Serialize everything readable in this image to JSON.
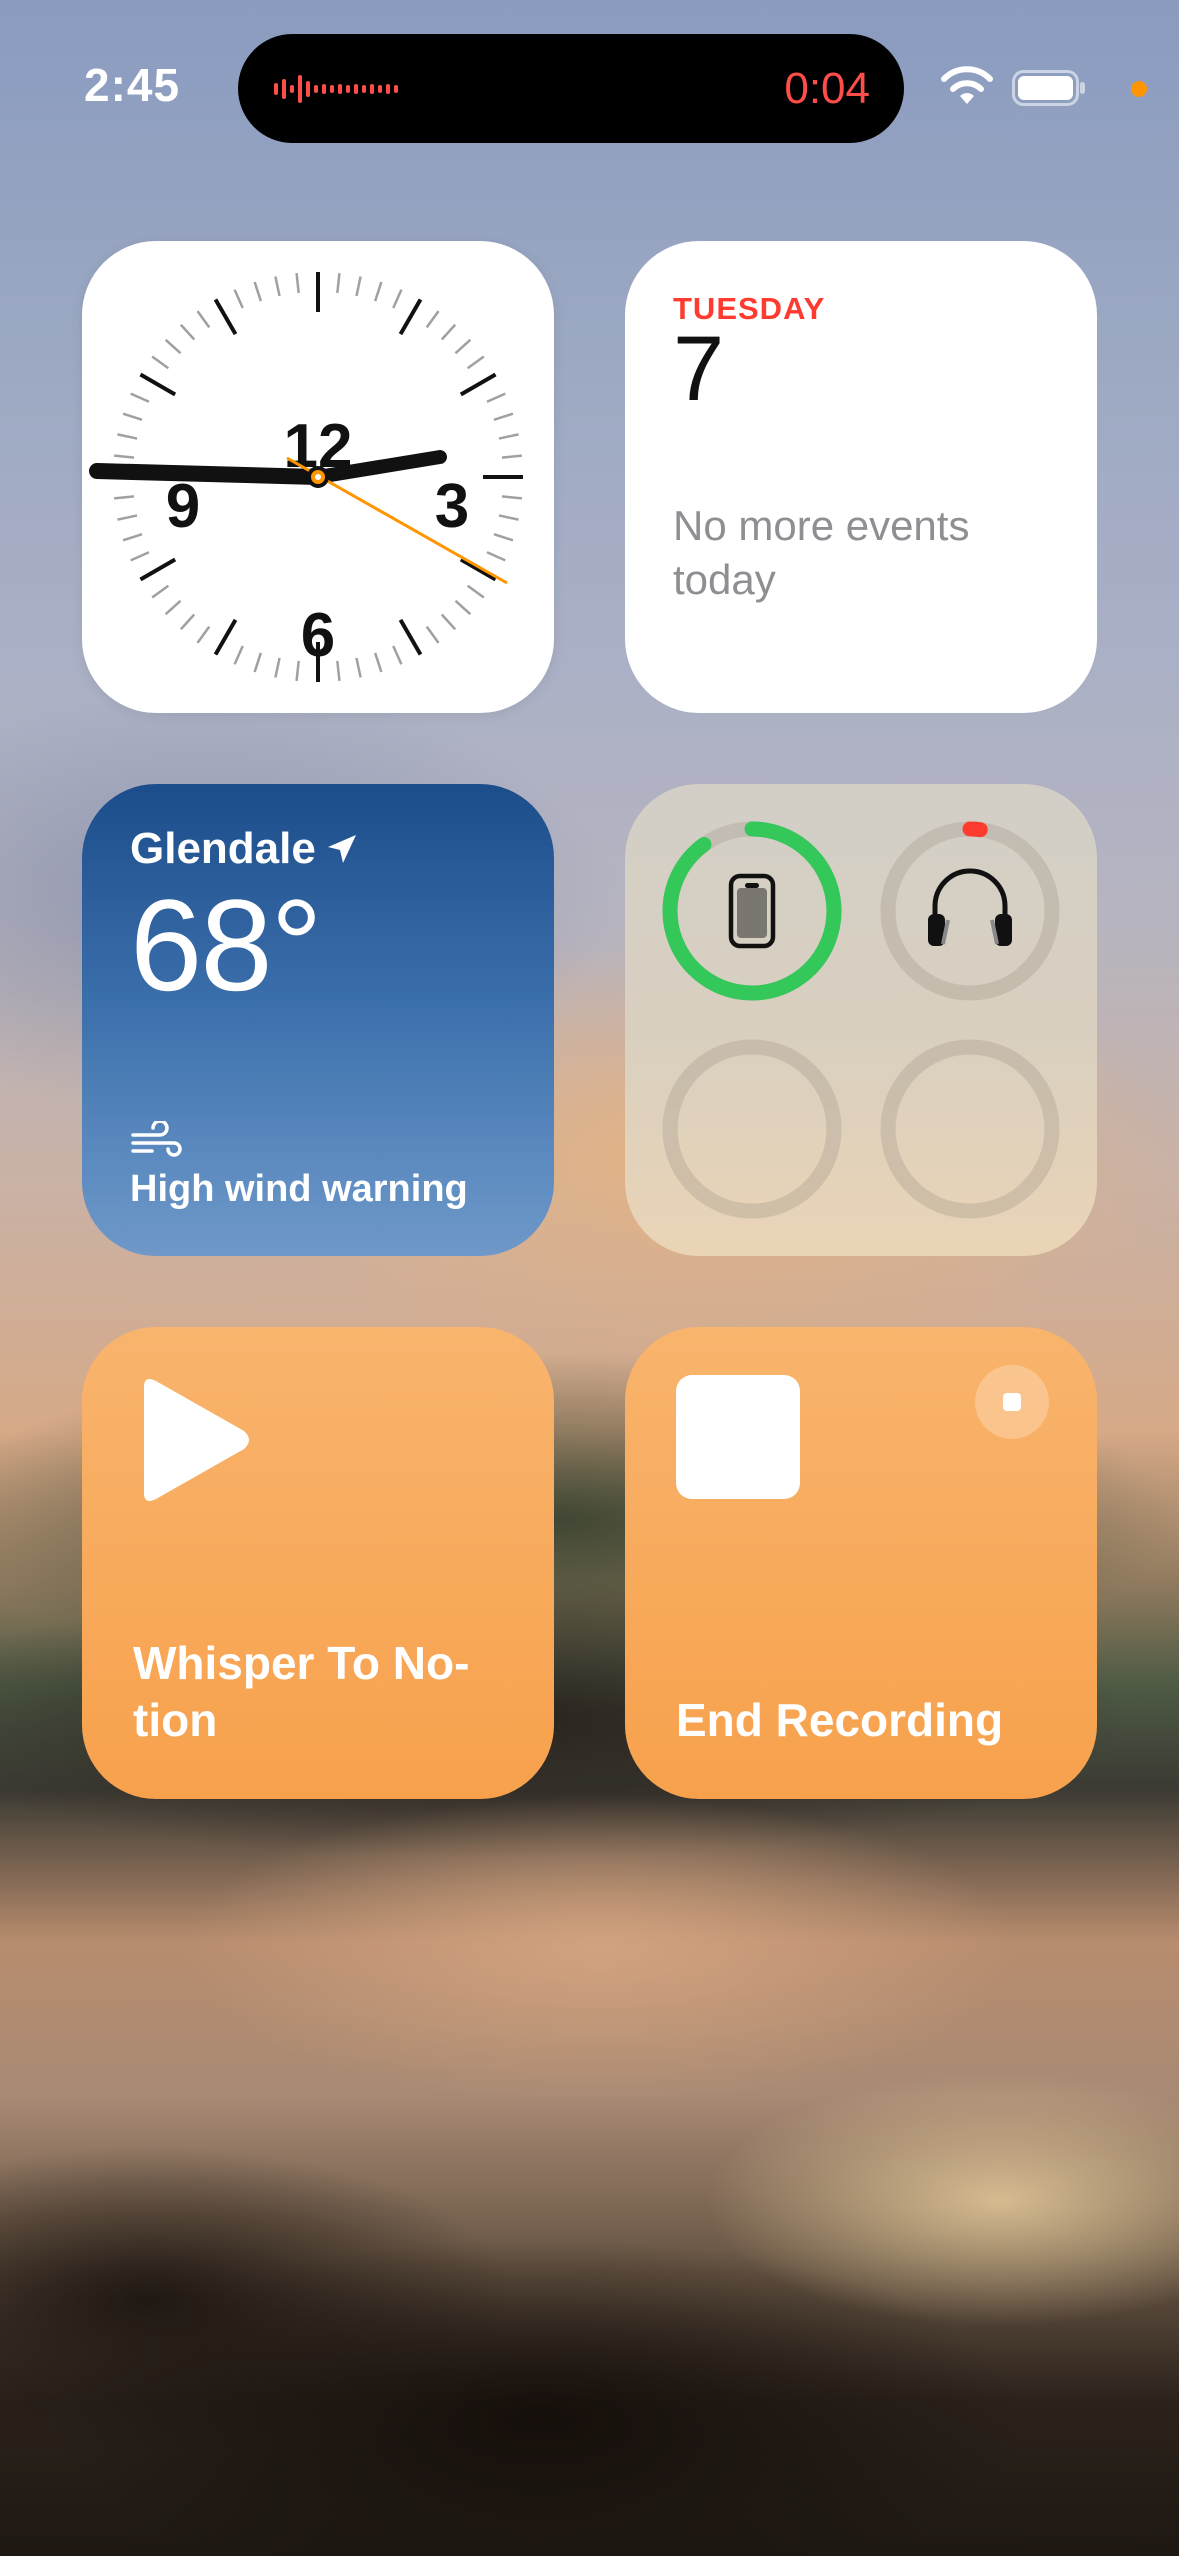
{
  "status_bar": {
    "time": "2:45",
    "recording_timer": "0:04",
    "icons": [
      "waveform-icon",
      "wifi-icon",
      "battery-icon",
      "privacy-indicator-dot"
    ],
    "recording_color": "#ff4d4a",
    "privacy_dot_color": "#ff9500"
  },
  "clock_widget": {
    "numerals": [
      "12",
      "3",
      "6",
      "9"
    ],
    "time_shown": "2:45",
    "second_hand_color": "#ff9500"
  },
  "calendar_widget": {
    "weekday": "TUESDAY",
    "date": "7",
    "events_text": "No more events today",
    "accent_color": "#ff3b30"
  },
  "weather_widget": {
    "city": "Glendale",
    "temperature": "68°",
    "alert": "High wind warning",
    "icons": [
      "location-arrow-icon",
      "wind-icon"
    ]
  },
  "batteries_widget": {
    "devices": [
      {
        "icon": "iphone-icon",
        "level": 0.9,
        "ring_color": "#34c759"
      },
      {
        "icon": "headphones-icon",
        "level": 0.02,
        "ring_color": "#ff3b30"
      },
      {
        "icon": "",
        "level": 0
      },
      {
        "icon": "",
        "level": 0
      }
    ]
  },
  "shortcuts": [
    {
      "label": "Whisper To No-\ntion",
      "icon": "play-icon"
    },
    {
      "label": "End Recording",
      "icon": "stop-icon",
      "badge_icon": "small-stop-icon"
    }
  ],
  "colors": {
    "shortcut_orange": "#f7a14c",
    "weather_blue": "#2b5f9c"
  }
}
